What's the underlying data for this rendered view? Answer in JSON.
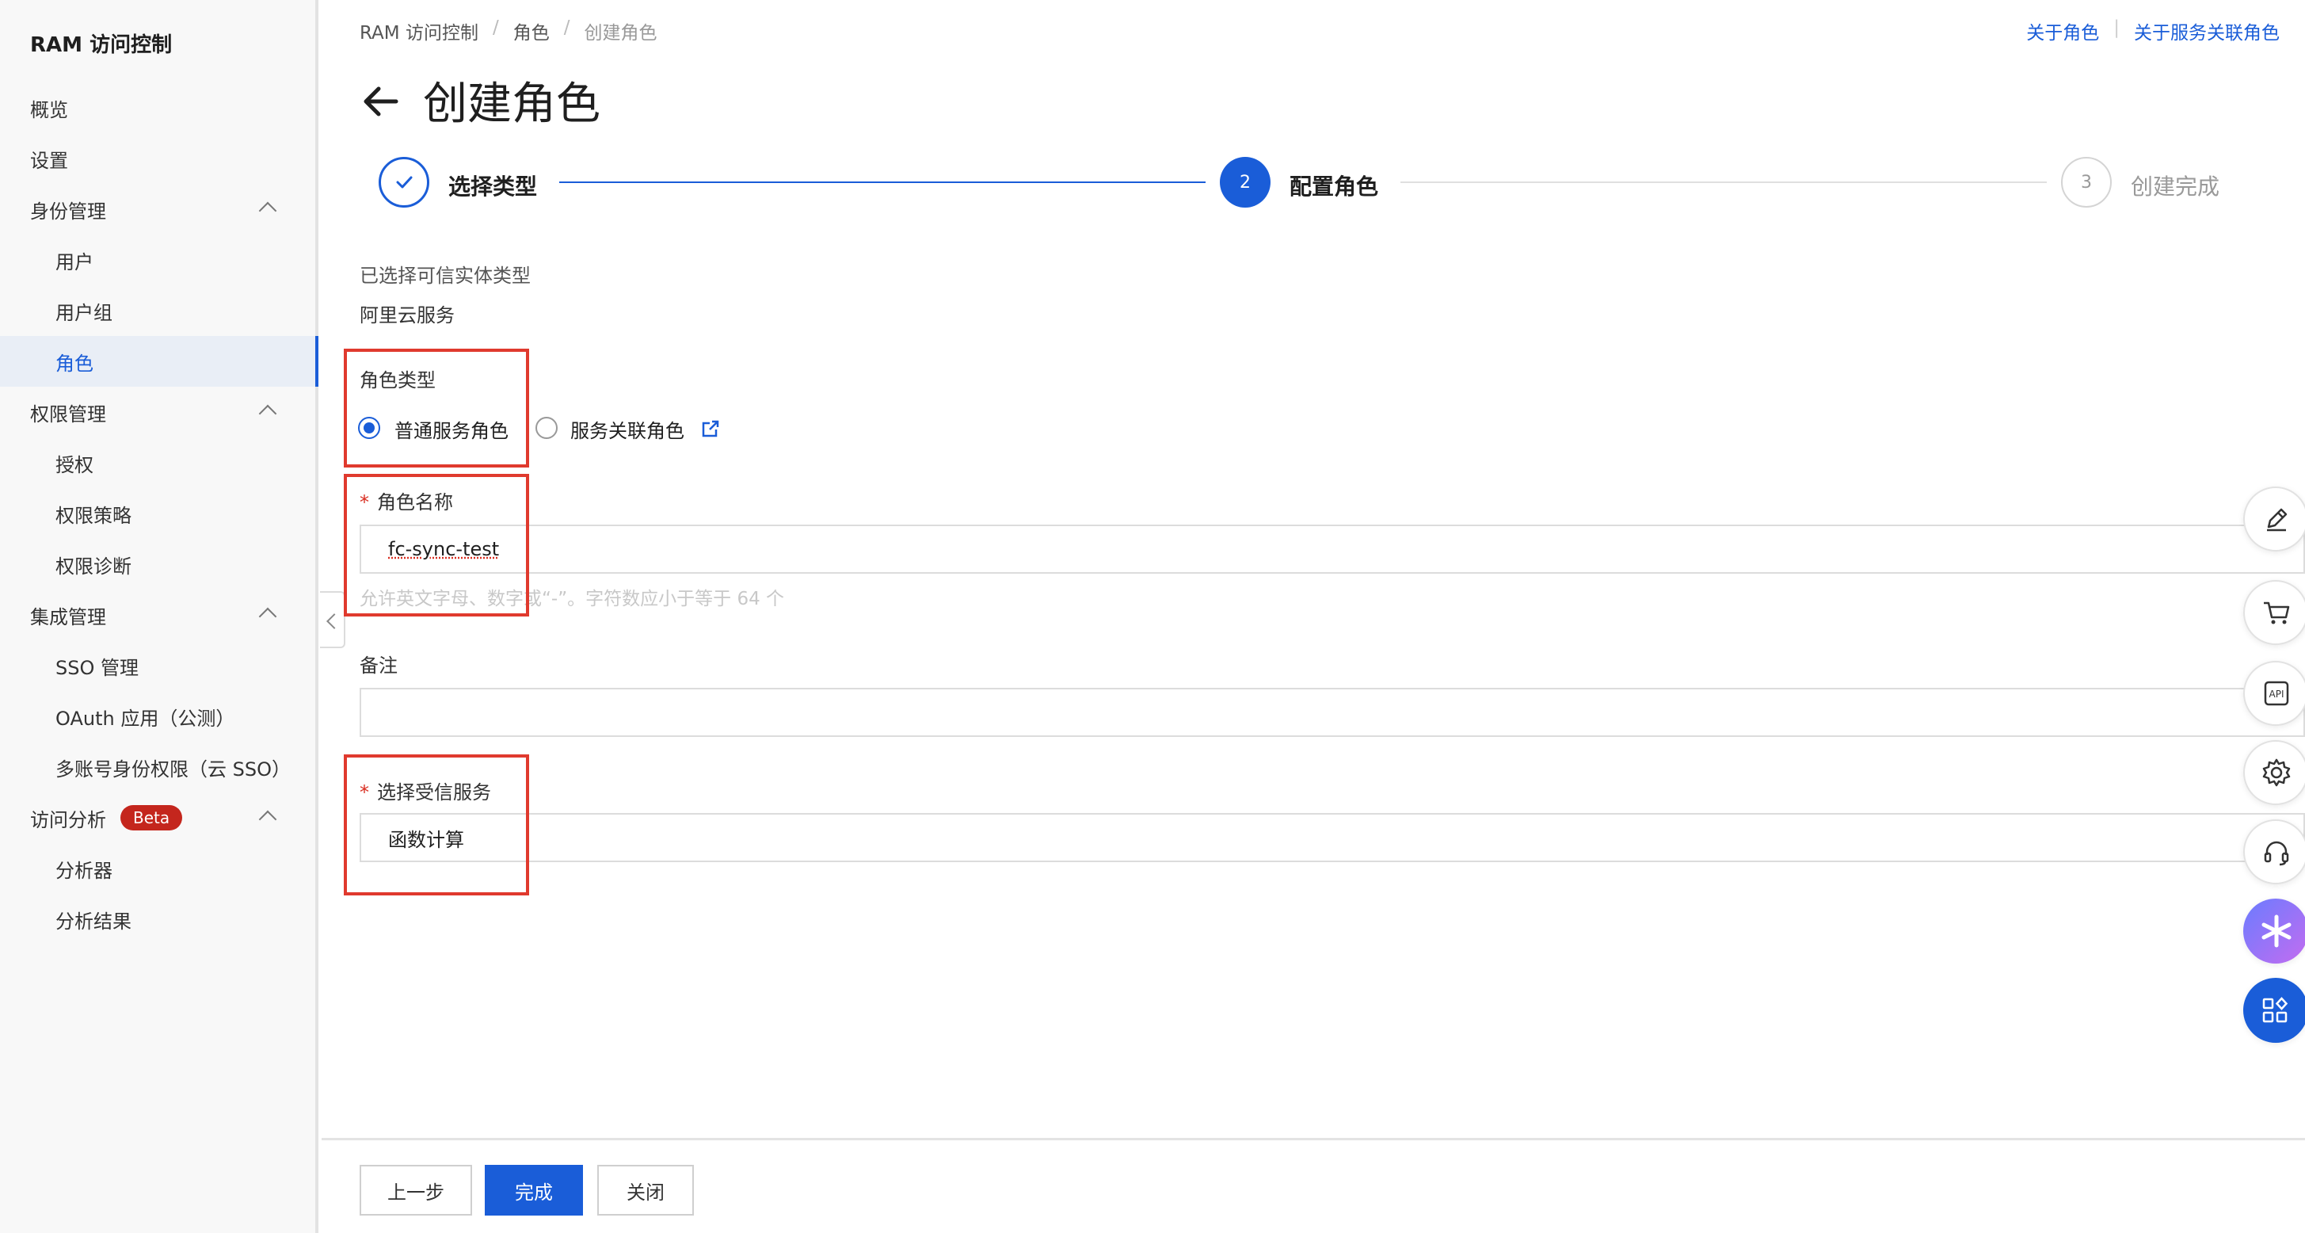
{
  "sidebar": {
    "title": "RAM 访问控制",
    "items": [
      {
        "label": "概览"
      },
      {
        "label": "设置"
      },
      {
        "label": "身份管理"
      },
      {
        "label": "用户"
      },
      {
        "label": "用户组"
      },
      {
        "label": "角色"
      },
      {
        "label": "权限管理"
      },
      {
        "label": "授权"
      },
      {
        "label": "权限策略"
      },
      {
        "label": "权限诊断"
      },
      {
        "label": "集成管理"
      },
      {
        "label": "SSO 管理"
      },
      {
        "label": "OAuth 应用（公测）"
      },
      {
        "label": "多账号身份权限（云 SSO）"
      },
      {
        "label": "访问分析",
        "badge": "Beta"
      },
      {
        "label": "分析器"
      },
      {
        "label": "分析结果"
      }
    ]
  },
  "breadcrumb": [
    "RAM 访问控制",
    "角色",
    "创建角色"
  ],
  "top_links": [
    "关于角色",
    "关于服务关联角色"
  ],
  "page_title": "创建角色",
  "steps": [
    {
      "label": "选择类型",
      "status": "done"
    },
    {
      "number": "2",
      "label": "配置角色",
      "status": "active"
    },
    {
      "number": "3",
      "label": "创建完成",
      "status": "wait"
    }
  ],
  "form": {
    "trusted_entity_label": "已选择可信实体类型",
    "trusted_entity_value": "阿里云服务",
    "role_type_label": "角色类型",
    "role_type_options": [
      "普通服务角色",
      "服务关联角色"
    ],
    "role_type_selected": "普通服务角色",
    "role_name_label": "角色名称",
    "role_name_value": "fc-sync-test",
    "role_name_hint": "允许英文字母、数字或“-”。字符数应小于等于 64 个",
    "note_label": "备注",
    "note_value": "",
    "trusted_service_label": "选择受信服务",
    "trusted_service_value": "函数计算",
    "required_mark": "*"
  },
  "footer": {
    "prev": "上一步",
    "finish": "完成",
    "close": "关闭"
  },
  "colors": {
    "primary": "#1a5dd8",
    "highlight_box": "#e03a2e",
    "beta_badge": "#c4261d",
    "sidebar_bg": "#f8f8f8"
  },
  "float_toolbar": [
    "edit-icon",
    "cart-icon",
    "api-icon",
    "settings-icon",
    "headset-icon",
    "ai-assistant-icon",
    "apps-icon"
  ]
}
